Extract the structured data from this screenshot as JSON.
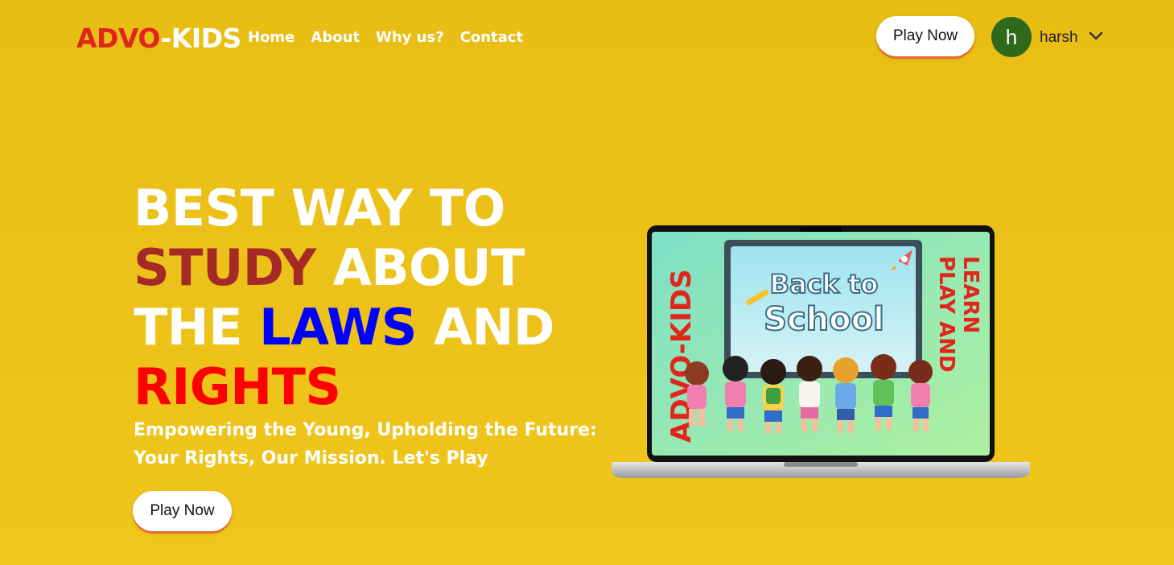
{
  "brand": {
    "part1": "ADVO",
    "part2": "-KIDS"
  },
  "nav": {
    "links": [
      "Home",
      "About",
      "Why us?",
      "Contact"
    ],
    "play_label": "Play Now",
    "user_initial": "h",
    "user_name": "harsh"
  },
  "hero": {
    "w1": "BEST WAY TO",
    "w2": "STUDY",
    "w3": "ABOUT",
    "w4": "THE",
    "w5": "LAWS",
    "w6": "AND",
    "w7": "RIGHTS",
    "subtitle_line1": "Empowering the Young, Upholding the Future:",
    "subtitle_line2": "Your Rights, Our Mission. Let's Play",
    "play_label": "Play Now"
  },
  "laptop_screen": {
    "left_text": "ADVO-KIDS",
    "right_text_1": "PLAY AND",
    "right_text_2": "LEARN",
    "board_line1": "Back to",
    "board_line2": "School"
  },
  "colors": {
    "background": "#ecc21a",
    "brand_red": "#e0251b",
    "study": "#a52a25",
    "laws": "#0000ff",
    "rights": "#ff0000",
    "avatar": "#2f6a1c"
  }
}
